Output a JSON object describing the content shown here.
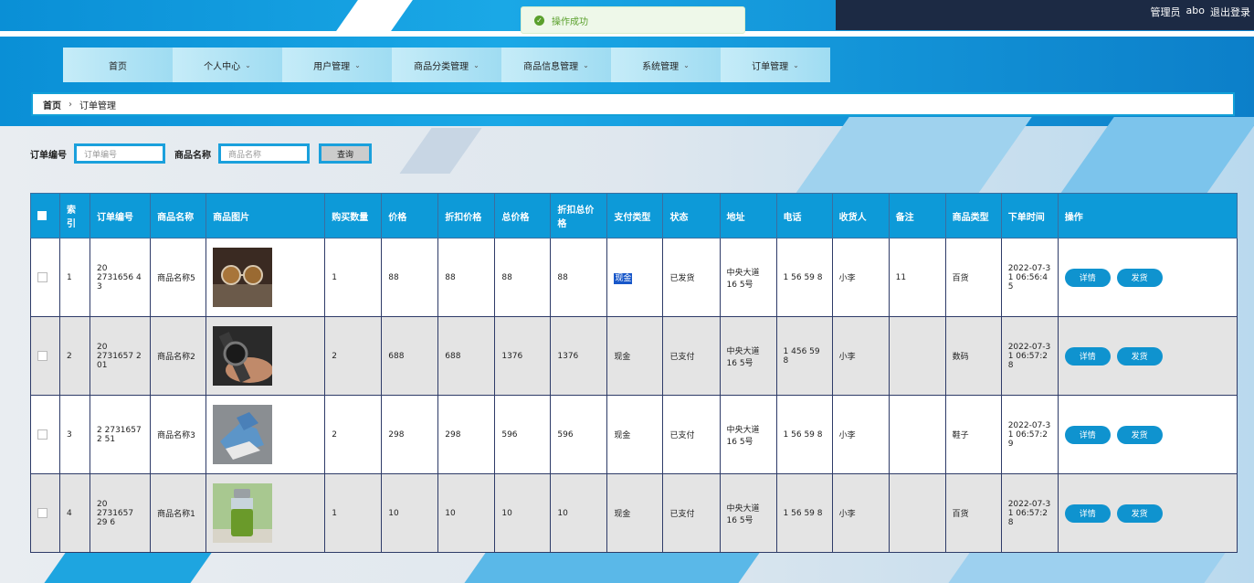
{
  "header": {
    "role_label": "管理员",
    "username": "abo",
    "logout_label": "退出登录"
  },
  "toast": {
    "message": "操作成功"
  },
  "nav": [
    {
      "label": "首页",
      "chevron": false
    },
    {
      "label": "个人中心",
      "chevron": true
    },
    {
      "label": "用户管理",
      "chevron": true
    },
    {
      "label": "商品分类管理",
      "chevron": true
    },
    {
      "label": "商品信息管理",
      "chevron": true
    },
    {
      "label": "系统管理",
      "chevron": true
    },
    {
      "label": "订单管理",
      "chevron": true
    }
  ],
  "breadcrumb": {
    "home": "首页",
    "current": "订单管理"
  },
  "search": {
    "order_no_label": "订单编号",
    "order_no_placeholder": "订单编号",
    "product_label": "商品名称",
    "product_placeholder": "商品名称",
    "query_label": "查询"
  },
  "table": {
    "headers": [
      "索引",
      "订单编号",
      "商品名称",
      "商品图片",
      "购买数量",
      "价格",
      "折扣价格",
      "总价格",
      "折扣总价格",
      "支付类型",
      "状态",
      "地址",
      "电话",
      "收货人",
      "备注",
      "商品类型",
      "下单时间",
      "操作"
    ],
    "rows": [
      {
        "index": "1",
        "order_no": "20 2731656 4 3",
        "name": "商品名称5",
        "image": "sunglasses-image",
        "qty": "1",
        "price": "88",
        "disc_price": "88",
        "total": "88",
        "disc_total": "88",
        "pay": "现金",
        "status": "已发货",
        "address": "中央大道16 5号",
        "phone": "1 56 59 8",
        "receiver": "小李",
        "note": "11",
        "type": "百货",
        "time": "2022-07-3 1 06:56:4 5",
        "detail": "详情",
        "ship": "发货"
      },
      {
        "index": "2",
        "order_no": "20 2731657 2 01",
        "name": "商品名称2",
        "image": "watch-image",
        "qty": "2",
        "price": "688",
        "disc_price": "688",
        "total": "1376",
        "disc_total": "1376",
        "pay": "现金",
        "status": "已支付",
        "address": "中央大道16 5号",
        "phone": "1 456 59 8",
        "receiver": "小李",
        "note": "",
        "type": "数码",
        "time": "2022-07-3 1 06:57:2 8",
        "detail": "详情",
        "ship": "发货"
      },
      {
        "index": "3",
        "order_no": "2 2731657 2 51",
        "name": "商品名称3",
        "image": "sneakers-image",
        "qty": "2",
        "price": "298",
        "disc_price": "298",
        "total": "596",
        "disc_total": "596",
        "pay": "现金",
        "status": "已支付",
        "address": "中央大道16 5号",
        "phone": "1 56 59 8",
        "receiver": "小李",
        "note": "",
        "type": "鞋子",
        "time": "2022-07-3 1 06:57:2 9",
        "detail": "详情",
        "ship": "发货"
      },
      {
        "index": "4",
        "order_no": "20 2731657 29 6",
        "name": "商品名称1",
        "image": "bottle-image",
        "qty": "1",
        "price": "10",
        "disc_price": "10",
        "total": "10",
        "disc_total": "10",
        "pay": "现金",
        "status": "已支付",
        "address": "中央大道16 5号",
        "phone": "1 56 59 8",
        "receiver": "小李",
        "note": "",
        "type": "百货",
        "time": "2022-07-3 1 06:57:2 8",
        "detail": "详情",
        "ship": "发货"
      }
    ]
  }
}
